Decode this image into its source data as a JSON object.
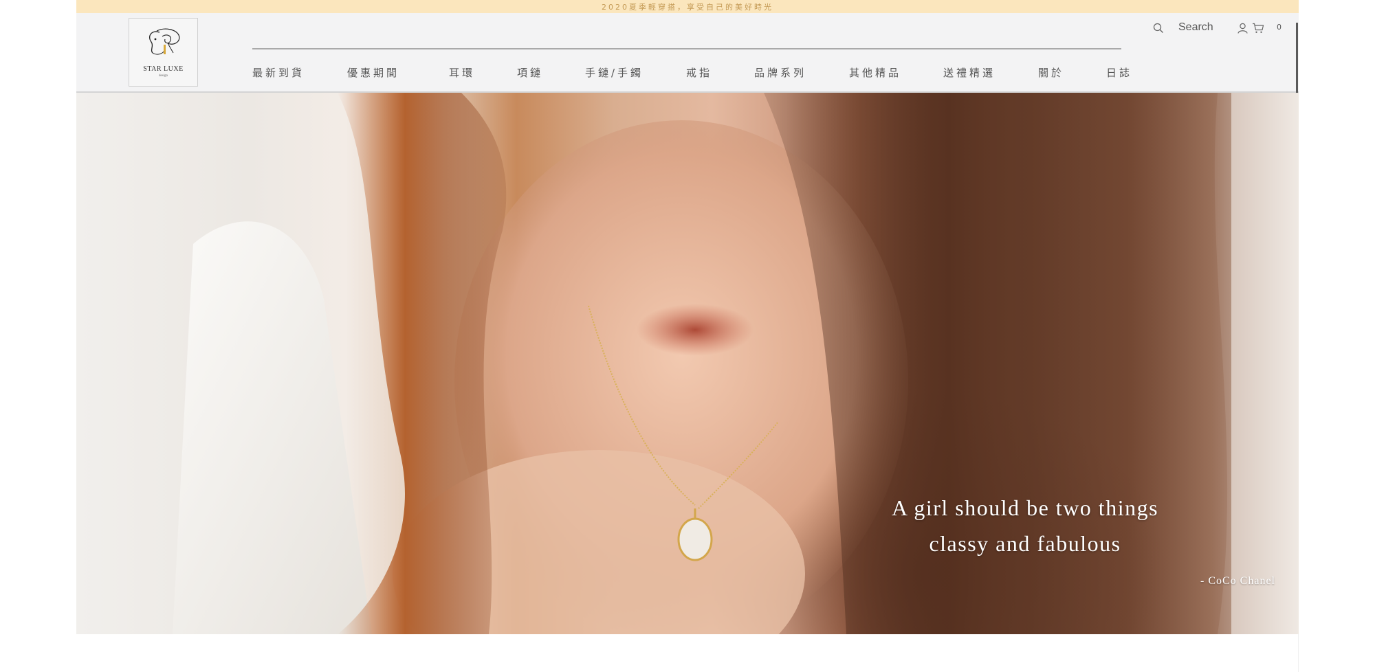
{
  "announcement": {
    "text": "2020夏季輕穿搭，享受自己的美好時光"
  },
  "logo": {
    "name": "STAR LUXE",
    "sub": "design"
  },
  "nav": {
    "items": [
      {
        "label": "最新到貨"
      },
      {
        "label": "優惠期間"
      },
      {
        "label": "耳環"
      },
      {
        "label": "項鏈"
      },
      {
        "label": "手鏈/手鐲"
      },
      {
        "label": "戒指"
      },
      {
        "label": "品牌系列"
      },
      {
        "label": "其他精品"
      },
      {
        "label": "送禮精選"
      },
      {
        "label": "關於"
      },
      {
        "label": "日誌"
      }
    ]
  },
  "header_tools": {
    "search_label": "Search",
    "search_icon": "search-icon",
    "user_icon": "user-icon",
    "cart_icon": "cart-icon",
    "cart_count": "0"
  },
  "hero": {
    "quote_line_1": "A girl should be two things",
    "quote_line_2": "classy and fabulous",
    "attribution": "- CoCo Chanel"
  },
  "colors": {
    "announcement_bg": "#fbe6bd",
    "announcement_text": "#c49a55",
    "header_bg": "#f3f3f4",
    "nav_text": "#555555",
    "quote_text": "#ffffff"
  }
}
